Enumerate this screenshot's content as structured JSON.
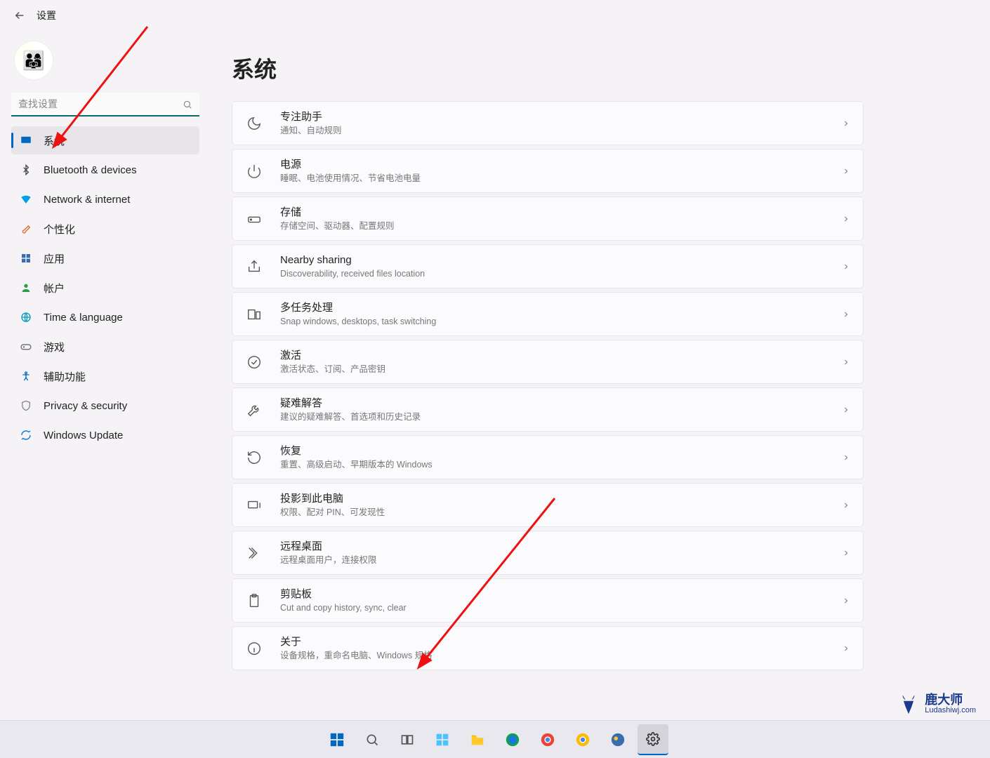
{
  "header": {
    "title": "设置"
  },
  "search": {
    "placeholder": "查找设置"
  },
  "sidebar": {
    "items": [
      {
        "label": "系统",
        "icon": "system"
      },
      {
        "label": "Bluetooth & devices",
        "icon": "bt"
      },
      {
        "label": "Network & internet",
        "icon": "net"
      },
      {
        "label": "个性化",
        "icon": "pers"
      },
      {
        "label": "应用",
        "icon": "apps"
      },
      {
        "label": "帐户",
        "icon": "acct"
      },
      {
        "label": "Time & language",
        "icon": "time"
      },
      {
        "label": "游戏",
        "icon": "game"
      },
      {
        "label": "辅助功能",
        "icon": "access"
      },
      {
        "label": "Privacy & security",
        "icon": "priv"
      },
      {
        "label": "Windows Update",
        "icon": "update"
      }
    ]
  },
  "page_title": "系统",
  "cards": [
    {
      "title": "专注助手",
      "sub": "通知、自动规则",
      "icon": "moon"
    },
    {
      "title": "电源",
      "sub": "睡眠、电池使用情况、节省电池电量",
      "icon": "power"
    },
    {
      "title": "存储",
      "sub": "存储空间、驱动器、配置规则",
      "icon": "storage"
    },
    {
      "title": "Nearby sharing",
      "sub": "Discoverability, received files location",
      "icon": "share"
    },
    {
      "title": "多任务处理",
      "sub": "Snap windows, desktops, task switching",
      "icon": "multitask"
    },
    {
      "title": "激活",
      "sub": "激活状态、订阅、产品密钥",
      "icon": "check"
    },
    {
      "title": "疑难解答",
      "sub": "建议的疑难解答、首选项和历史记录",
      "icon": "wrench"
    },
    {
      "title": "恢复",
      "sub": "重置、高级启动、早期版本的 Windows",
      "icon": "recover"
    },
    {
      "title": "投影到此电脑",
      "sub": "权限、配对 PIN、可发现性",
      "icon": "project"
    },
    {
      "title": "远程桌面",
      "sub": "远程桌面用户，连接权限",
      "icon": "remote"
    },
    {
      "title": "剪贴板",
      "sub": "Cut and copy history, sync, clear",
      "icon": "clipboard"
    },
    {
      "title": "关于",
      "sub": "设备规格，重命名电脑、Windows 规格",
      "icon": "info"
    }
  ],
  "watermark": {
    "cn": "鹿大师",
    "en": "Ludashiwj.com"
  }
}
